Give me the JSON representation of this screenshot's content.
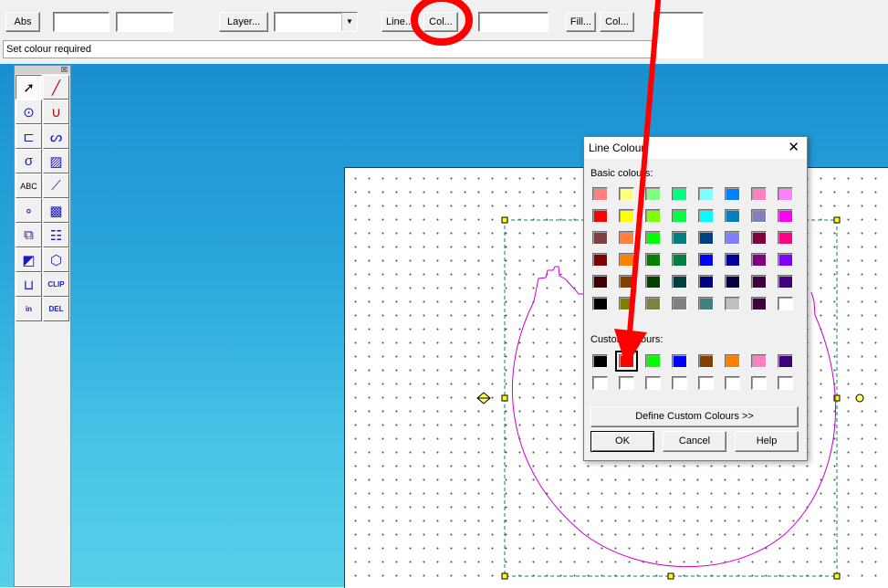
{
  "toolbar": {
    "abs_label": "Abs",
    "layer_label": "Layer...",
    "line_label": "Line...",
    "line_col_label": "Col...",
    "fill_label": "Fill...",
    "fill_col_label": "Col...",
    "status_text": "Set colour required"
  },
  "palette_tools": [
    {
      "name": "select-arrow-tool",
      "icon": "arrow-icon"
    },
    {
      "name": "line-tool",
      "icon": "line-icon"
    },
    {
      "name": "circle-radius-tool",
      "icon": "circle-radius-icon"
    },
    {
      "name": "arc-tool",
      "icon": "arc-icon"
    },
    {
      "name": "dimension-tool",
      "icon": "dimension-icon"
    },
    {
      "name": "curve-tool",
      "icon": "curve-icon"
    },
    {
      "name": "shape-tool",
      "icon": "shape-icon"
    },
    {
      "name": "hatch-tool",
      "icon": "hatch-icon"
    },
    {
      "name": "text-tool",
      "icon": "text-icon",
      "text": "ABC"
    },
    {
      "name": "measure-tool",
      "icon": "measure-icon"
    },
    {
      "name": "points-tool",
      "icon": "points-icon"
    },
    {
      "name": "pattern-fill-tool",
      "icon": "pattern-icon"
    },
    {
      "name": "group-tool",
      "icon": "group-icon"
    },
    {
      "name": "table-tool",
      "icon": "table-icon"
    },
    {
      "name": "colour-tool",
      "icon": "colour-square-icon"
    },
    {
      "name": "solid-tool",
      "icon": "solid-icon"
    },
    {
      "name": "trim-tool",
      "icon": "trim-icon"
    },
    {
      "name": "clip-tool",
      "icon": "clip-icon",
      "text": "CLIP"
    },
    {
      "name": "insert-tool",
      "icon": "insert-icon",
      "text": "in"
    },
    {
      "name": "delete-tool",
      "icon": "delete-icon",
      "text": "DEL"
    }
  ],
  "dialog": {
    "title": "Line Colour",
    "basic_label": "Basic colours:",
    "custom_label": "Custom colours:",
    "define_button": "Define Custom Colours >>",
    "ok_button": "OK",
    "cancel_button": "Cancel",
    "help_button": "Help",
    "basic_colors": [
      [
        "#ff8080",
        "#ffff80",
        "#80ff80",
        "#00ff80",
        "#80ffff",
        "#0080ff",
        "#ff80c0",
        "#ff80ff"
      ],
      [
        "#ff0000",
        "#ffff00",
        "#80ff00",
        "#00ff40",
        "#00ffff",
        "#0080c0",
        "#8080c0",
        "#ff00ff"
      ],
      [
        "#804040",
        "#ff8040",
        "#00ff00",
        "#008080",
        "#004080",
        "#8080ff",
        "#800040",
        "#ff0080"
      ],
      [
        "#800000",
        "#ff8000",
        "#008000",
        "#008040",
        "#0000ff",
        "#0000a0",
        "#800080",
        "#8000ff"
      ],
      [
        "#400000",
        "#804000",
        "#004000",
        "#004040",
        "#000080",
        "#000040",
        "#400040",
        "#400080"
      ],
      [
        "#000000",
        "#808000",
        "#808040",
        "#808080",
        "#408080",
        "#c0c0c0",
        "#400040",
        "#ffffff"
      ]
    ],
    "custom_colors": [
      [
        "#000000",
        "#ff0000",
        "#00ff00",
        "#0000ff",
        "#804000",
        "#ff8000",
        "#ff80c0",
        "#400080"
      ],
      [
        "#ffffff",
        "#ffffff",
        "#ffffff",
        "#ffffff",
        "#ffffff",
        "#ffffff",
        "#ffffff",
        "#ffffff"
      ]
    ],
    "selected_custom": "#ff0000"
  },
  "colors": {
    "annotation_red": "#ff0000",
    "drawing_magenta": "#cc00cc",
    "selection_box": "#008080"
  }
}
